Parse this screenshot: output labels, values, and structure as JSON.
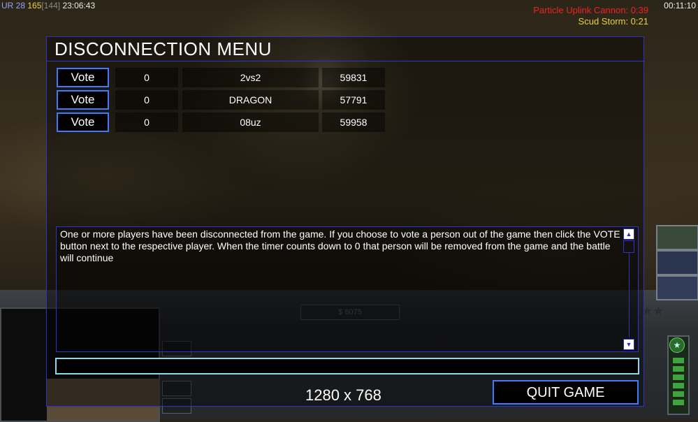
{
  "hud": {
    "rank": "UR 28",
    "money": "165",
    "bracket": "[144]",
    "clock_time": "23:06:43",
    "game_timer": "00:11:10",
    "superweapons": [
      {
        "label": "Particle Uplink Cannon: 0:39",
        "color": "#ee2222"
      },
      {
        "label": "Scud Storm: 0:21",
        "color": "#e8d23a"
      }
    ]
  },
  "menu": {
    "title": "DISCONNECTION MENU",
    "players": [
      {
        "vote_label": "Vote",
        "votes": "0",
        "name": "2vs2",
        "timer": "59831"
      },
      {
        "vote_label": "Vote",
        "votes": "0",
        "name": "DRAGON",
        "timer": "57791"
      },
      {
        "vote_label": "Vote",
        "votes": "0",
        "name": "08uz",
        "timer": "59958"
      }
    ],
    "info_text": "One or more players have been disconnected from the game. If you choose to vote a person out of the game then click the VOTE button next to the respective player. When the timer counts down to 0 that person will be removed from the game and the battle will continue",
    "chat_value": "",
    "resolution": "1280 x 768",
    "quit_label": "QUIT GAME"
  },
  "colors": {
    "panel_border": "#2e34c9",
    "button_border": "#3e7bff",
    "chat_border": "#8dd7e8"
  }
}
